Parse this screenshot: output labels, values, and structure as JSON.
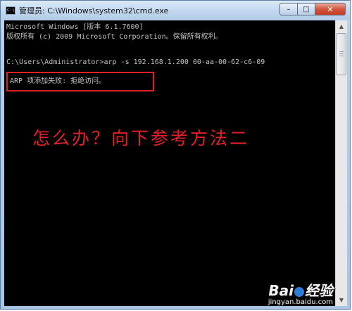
{
  "window": {
    "title": "管理员: C:\\Windows\\system32\\cmd.exe",
    "icon": "cmd-icon",
    "buttons": {
      "minimize": "–",
      "maximize": "□",
      "close": "✕"
    }
  },
  "console": {
    "lines": [
      "Microsoft Windows [版本 6.1.7600]",
      "版权所有 (c) 2009 Microsoft Corporation。保留所有权利。",
      "C:\\Users\\Administrator>arp -s 192.168.1.200 00-aa-00-62-c6-09",
      "ARP 项添加失败: 拒绝访问。"
    ],
    "annotation": "怎么办？向下参考方法二",
    "highlight_color": "#e02020",
    "text_color": "#c0c0c0",
    "background_color": "#000000"
  },
  "watermark": {
    "brand_left": "Bai",
    "brand_right": "经验",
    "site": "jingyan.baidu.com"
  }
}
